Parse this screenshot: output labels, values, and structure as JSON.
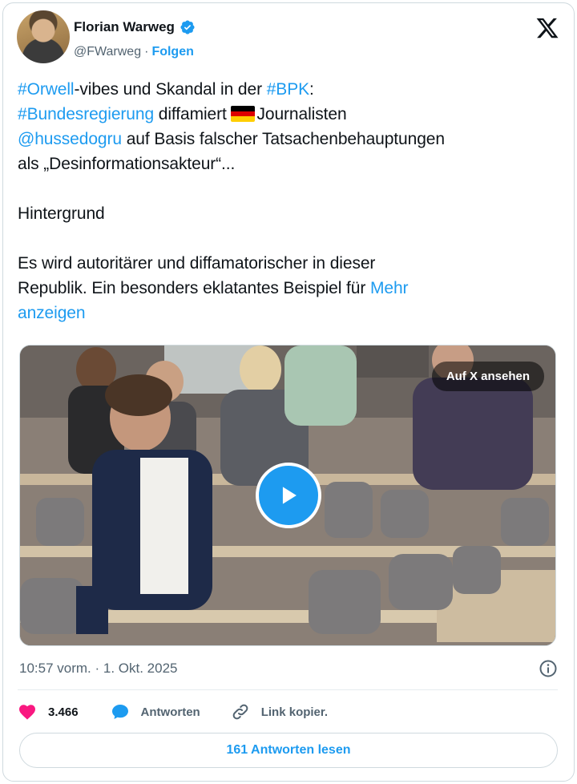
{
  "author": {
    "name": "Florian Warweg",
    "handle": "@FWarweg",
    "separator": "·",
    "follow_label": "Folgen"
  },
  "tweet": {
    "line1": {
      "tag1": "#Orwell",
      "text1": "-vibes und Skandal in der ",
      "tag2": "#BPK",
      "text2": ":"
    },
    "line2": {
      "tag": "#Bundesregierung",
      "text1": " diffamiert ",
      "text2": "Journalisten"
    },
    "line3": {
      "mention": "@hussedogru",
      "text": " auf Basis falscher Tatsachenbehauptungen"
    },
    "line4": "als  „Desinformationsakteur“...",
    "line5": "Hintergrund",
    "line6": "Es wird autoritärer und diffamatorischer in dieser",
    "line7": {
      "text": "Republik. Ein besonders eklatantes Beispiel für ",
      "more": "Mehr"
    },
    "line8": "anzeigen"
  },
  "media": {
    "view_on_x_label": "Auf X ansehen"
  },
  "meta": {
    "timestamp": "10:57 vorm. · 1. Okt. 2025"
  },
  "actions": {
    "like_count": "3.466",
    "reply_label": "Antworten",
    "copy_link_label": "Link kopier."
  },
  "read_replies_label": "161 Antworten lesen",
  "colors": {
    "accent": "#1d9bf0",
    "like": "#f91880",
    "text": "#0f1419",
    "muted": "#536471"
  }
}
